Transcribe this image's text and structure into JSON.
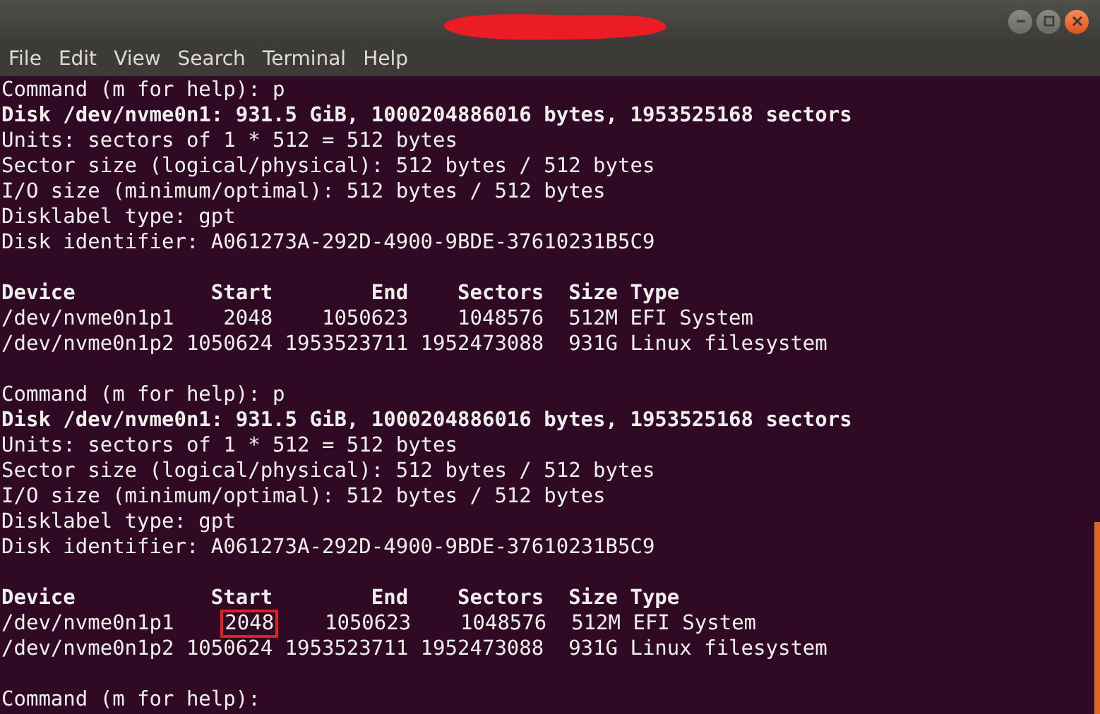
{
  "menu": [
    "File",
    "Edit",
    "View",
    "Search",
    "Terminal",
    "Help"
  ],
  "terminal": {
    "lines": [
      {
        "kind": "text",
        "bold": false,
        "text": "Command (m for help): p"
      },
      {
        "kind": "text",
        "bold": true,
        "text": "Disk /dev/nvme0n1: 931.5 GiB, 1000204886016 bytes, 1953525168 sectors"
      },
      {
        "kind": "text",
        "bold": false,
        "text": "Units: sectors of 1 * 512 = 512 bytes"
      },
      {
        "kind": "text",
        "bold": false,
        "text": "Sector size (logical/physical): 512 bytes / 512 bytes"
      },
      {
        "kind": "text",
        "bold": false,
        "text": "I/O size (minimum/optimal): 512 bytes / 512 bytes"
      },
      {
        "kind": "text",
        "bold": false,
        "text": "Disklabel type: gpt"
      },
      {
        "kind": "text",
        "bold": false,
        "text": "Disk identifier: A061273A-292D-4900-9BDE-37610231B5C9"
      },
      {
        "kind": "blank"
      },
      {
        "kind": "text",
        "bold": true,
        "text": "Device           Start        End    Sectors  Size Type"
      },
      {
        "kind": "text",
        "bold": false,
        "text": "/dev/nvme0n1p1    2048    1050623    1048576  512M EFI System"
      },
      {
        "kind": "text",
        "bold": false,
        "text": "/dev/nvme0n1p2 1050624 1953523711 1952473088  931G Linux filesystem"
      },
      {
        "kind": "blank"
      },
      {
        "kind": "text",
        "bold": false,
        "text": "Command (m for help): p"
      },
      {
        "kind": "text",
        "bold": true,
        "text": "Disk /dev/nvme0n1: 931.5 GiB, 1000204886016 bytes, 1953525168 sectors"
      },
      {
        "kind": "text",
        "bold": false,
        "text": "Units: sectors of 1 * 512 = 512 bytes"
      },
      {
        "kind": "text",
        "bold": false,
        "text": "Sector size (logical/physical): 512 bytes / 512 bytes"
      },
      {
        "kind": "text",
        "bold": false,
        "text": "I/O size (minimum/optimal): 512 bytes / 512 bytes"
      },
      {
        "kind": "text",
        "bold": false,
        "text": "Disklabel type: gpt"
      },
      {
        "kind": "text",
        "bold": false,
        "text": "Disk identifier: A061273A-292D-4900-9BDE-37610231B5C9"
      },
      {
        "kind": "blank"
      },
      {
        "kind": "text",
        "bold": true,
        "text": "Device           Start        End    Sectors  Size Type"
      },
      {
        "kind": "segments",
        "segments": [
          {
            "text": "/dev/nvme0n1p1    ",
            "highlighted": false
          },
          {
            "text": "2048",
            "highlighted": true
          },
          {
            "text": "    1050623    1048576  512M EFI System",
            "highlighted": false
          }
        ]
      },
      {
        "kind": "text",
        "bold": false,
        "text": "/dev/nvme0n1p2 1050624 1953523711 1952473088  931G Linux filesystem"
      },
      {
        "kind": "blank"
      },
      {
        "kind": "text",
        "bold": false,
        "text": "Command (m for help):"
      }
    ]
  }
}
